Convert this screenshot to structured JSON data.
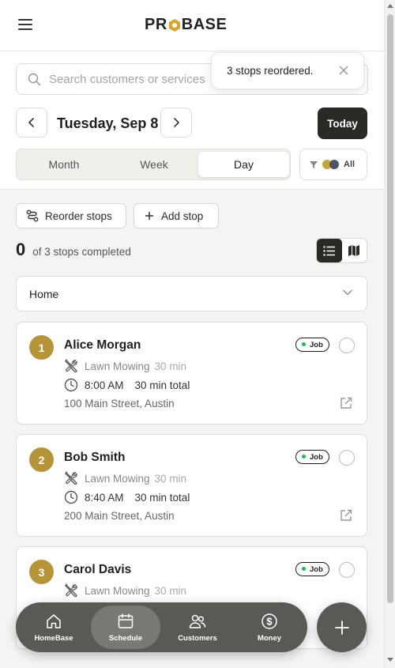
{
  "header": {
    "logo_left": "PR",
    "logo_right": "BASE",
    "menu_icon": "hamburger-icon"
  },
  "search": {
    "placeholder": "Search customers or services"
  },
  "toast": {
    "message": "3 stops reordered.",
    "close_icon": "close-icon"
  },
  "date_nav": {
    "title": "Tuesday, Sep 8",
    "today_label": "Today"
  },
  "view_tabs": [
    {
      "label": "Month",
      "active": false
    },
    {
      "label": "Week",
      "active": false
    },
    {
      "label": "Day",
      "active": true
    }
  ],
  "filter": {
    "label": "All"
  },
  "actions": {
    "reorder_label": "Reorder stops",
    "add_label": "Add stop"
  },
  "progress": {
    "completed": "0",
    "text": "of 3 stops completed"
  },
  "start_location": {
    "label": "Home"
  },
  "stops": [
    {
      "number": "1",
      "name": "Alice Morgan",
      "badge": "Job",
      "service": "Lawn Mowing",
      "duration": "30 min",
      "time": "8:00 AM",
      "total": "30 min total",
      "address": "100 Main Street, Austin"
    },
    {
      "number": "2",
      "name": "Bob Smith",
      "badge": "Job",
      "service": "Lawn Mowing",
      "duration": "30 min",
      "time": "8:40 AM",
      "total": "30 min total",
      "address": "200 Main Street, Austin"
    },
    {
      "number": "3",
      "name": "Carol Davis",
      "badge": "Job",
      "service": "Lawn Mowing",
      "duration": "30 min",
      "time": "",
      "total": "",
      "address": ""
    }
  ],
  "bottom_nav": [
    {
      "label": "HomeBase",
      "icon": "home-icon",
      "active": false
    },
    {
      "label": "Schedule",
      "icon": "calendar-icon",
      "active": true
    },
    {
      "label": "Customers",
      "icon": "users-icon",
      "active": false
    },
    {
      "label": "Money",
      "icon": "dollar-icon",
      "active": false
    }
  ],
  "colors": {
    "accent": "#b6953a",
    "dark": "#2b2926",
    "nav_bg": "#5b5956",
    "status_green": "#1db954"
  }
}
